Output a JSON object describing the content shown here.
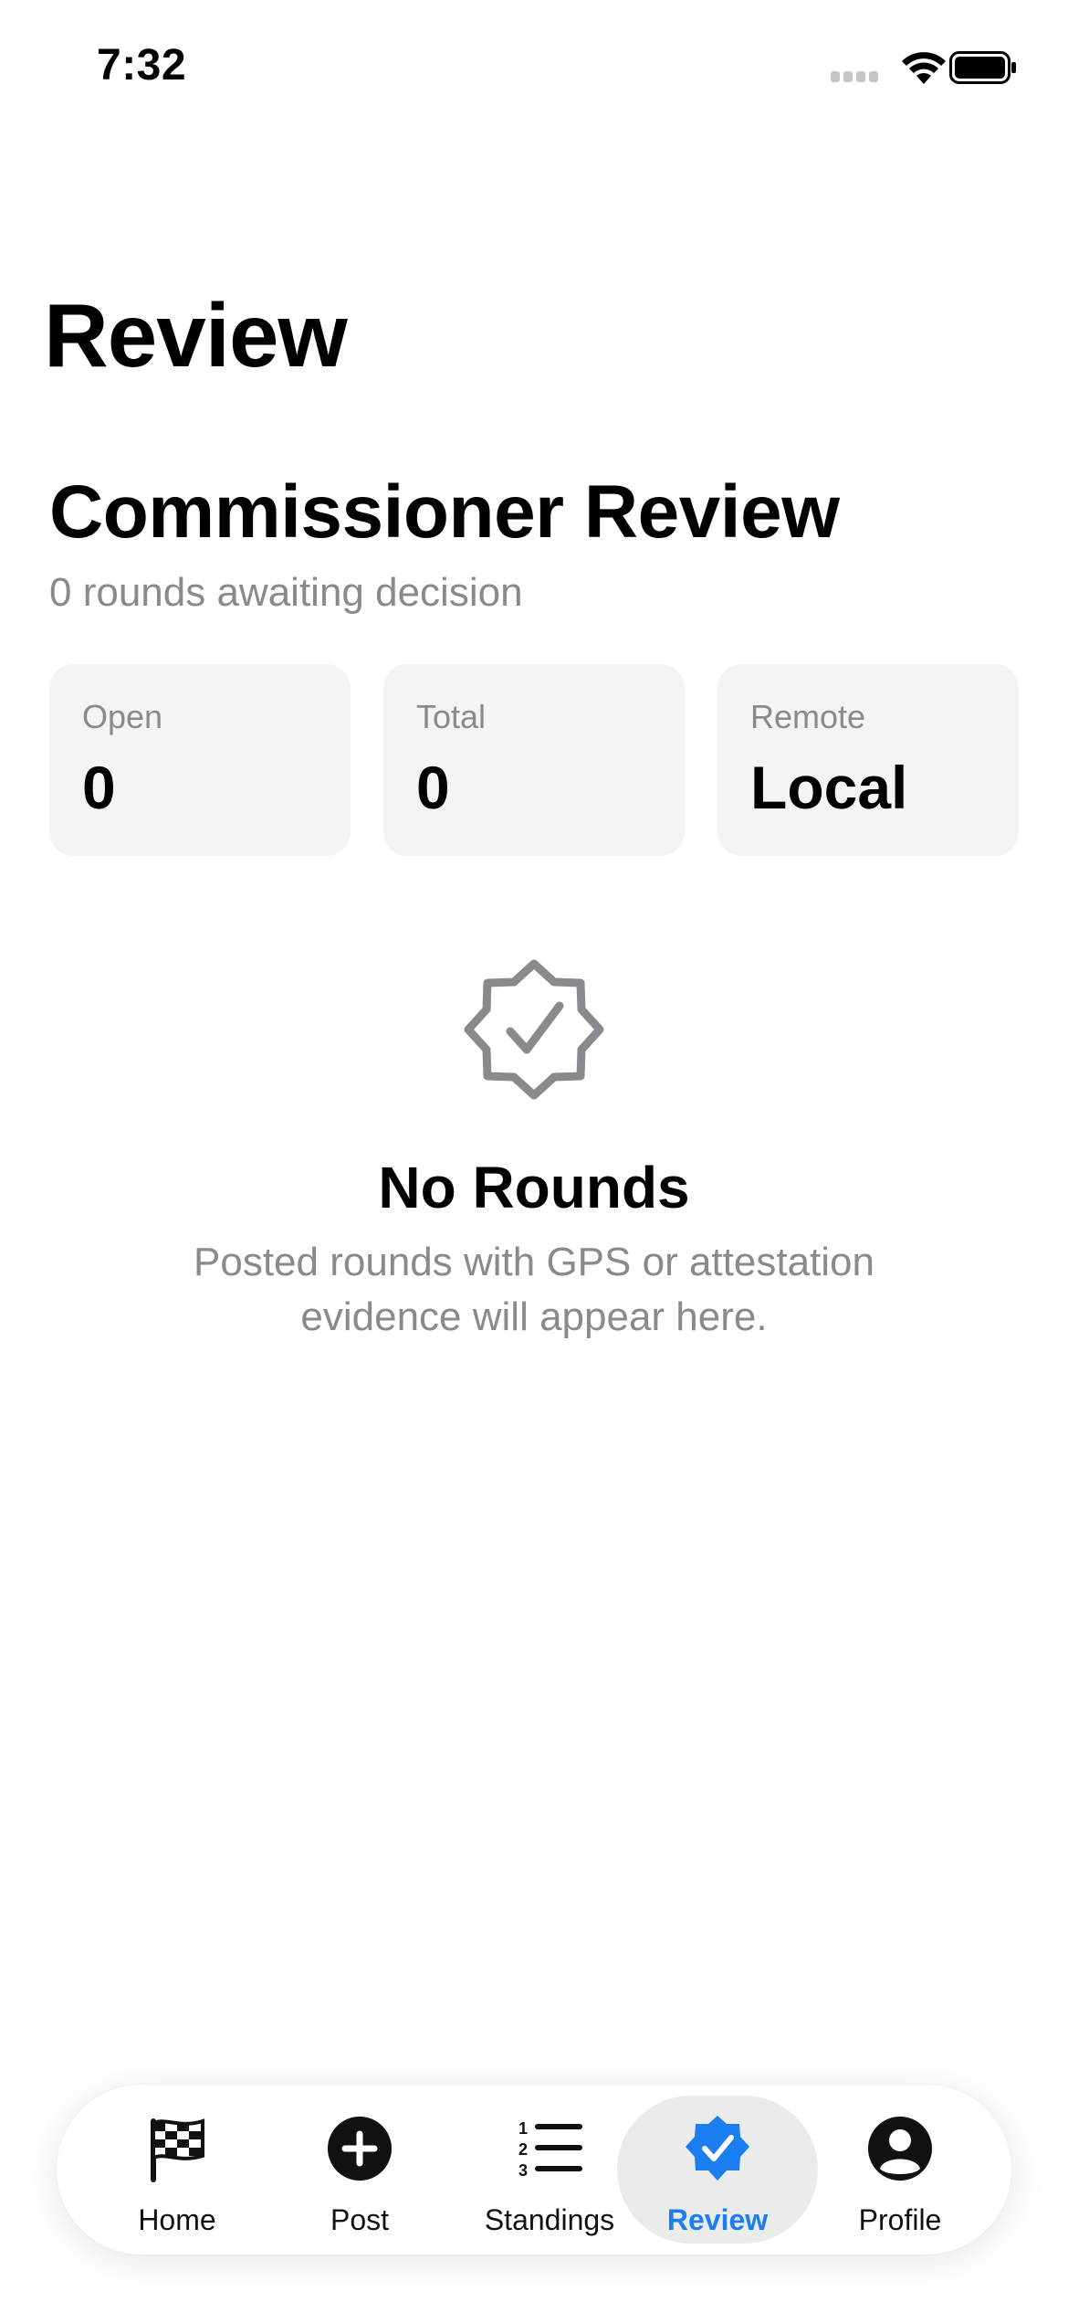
{
  "status_bar": {
    "time": "7:32"
  },
  "page": {
    "title": "Review"
  },
  "section": {
    "title": "Commissioner Review",
    "subtitle": "0 rounds awaiting decision"
  },
  "stats": [
    {
      "label": "Open",
      "value": "0"
    },
    {
      "label": "Total",
      "value": "0"
    },
    {
      "label": "Remote",
      "value": "Local"
    }
  ],
  "empty_state": {
    "icon": "checkmark-seal-icon",
    "title": "No Rounds",
    "text_line1": "Posted rounds with GPS or attestation",
    "text_line2": "evidence will appear here."
  },
  "tab_bar": {
    "active": "Review",
    "accent_color": "#1a7df0",
    "tabs": [
      {
        "label": "Home",
        "icon": "checkered-flag-icon"
      },
      {
        "label": "Post",
        "icon": "plus-circle-icon"
      },
      {
        "label": "Standings",
        "icon": "numbered-list-icon"
      },
      {
        "label": "Review",
        "icon": "checkmark-seal-icon"
      },
      {
        "label": "Profile",
        "icon": "person-circle-icon"
      }
    ]
  }
}
